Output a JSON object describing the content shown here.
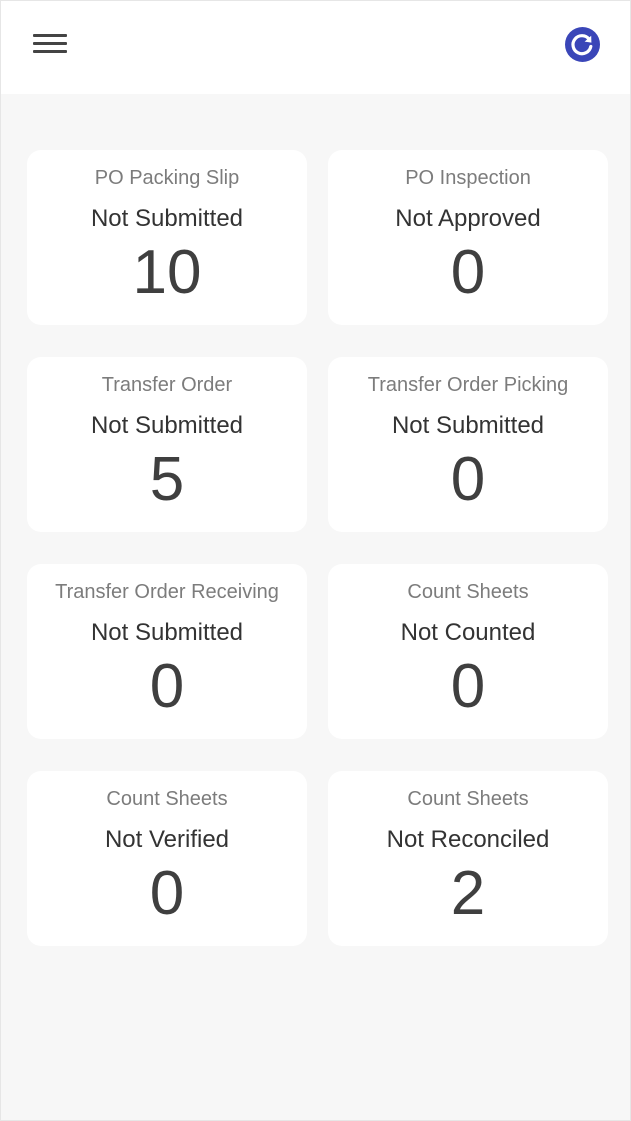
{
  "header": {
    "menu_icon": "hamburger-menu-icon",
    "refresh_icon": "refresh-icon",
    "accent_color": "#3a46b8"
  },
  "cards": [
    {
      "title": "PO Packing Slip",
      "status": "Not Submitted",
      "count": "10"
    },
    {
      "title": "PO Inspection",
      "status": "Not Approved",
      "count": "0"
    },
    {
      "title": "Transfer Order",
      "status": "Not Submitted",
      "count": "5"
    },
    {
      "title": "Transfer Order Picking",
      "status": "Not Submitted",
      "count": "0"
    },
    {
      "title": "Transfer Order Receiving",
      "status": "Not Submitted",
      "count": "0"
    },
    {
      "title": "Count Sheets",
      "status": "Not Counted",
      "count": "0"
    },
    {
      "title": "Count Sheets",
      "status": "Not Verified",
      "count": "0"
    },
    {
      "title": "Count Sheets",
      "status": "Not Reconciled",
      "count": "2"
    }
  ]
}
